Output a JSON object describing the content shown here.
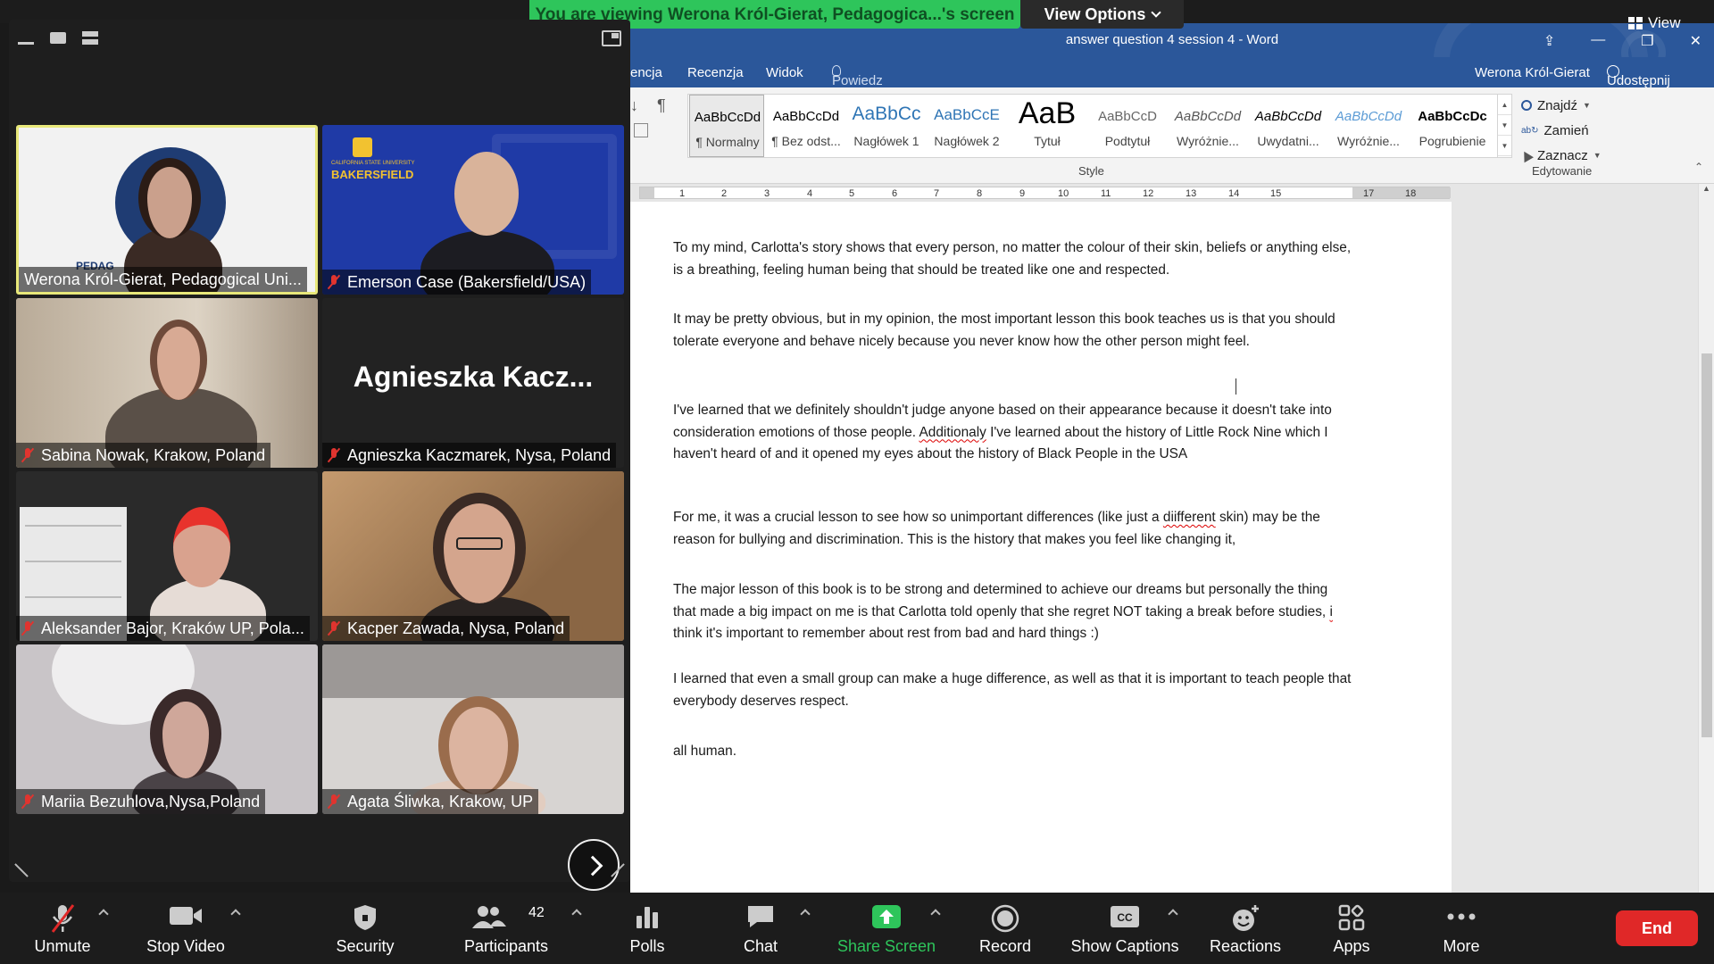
{
  "zoom": {
    "banner": "You are viewing Werona Król-Gierat, Pedagogica...'s screen",
    "view_options": "View Options",
    "view": "View",
    "toolbar": {
      "unmute": "Unmute",
      "stop_video": "Stop Video",
      "security": "Security",
      "participants": "Participants",
      "participants_count": "42",
      "polls": "Polls",
      "chat": "Chat",
      "share_screen": "Share Screen",
      "record": "Record",
      "show_captions": "Show Captions",
      "reactions": "Reactions",
      "apps": "Apps",
      "more": "More",
      "end": "End"
    },
    "participants": [
      {
        "name": "Werona Król-Gierat, Pedagogical Uni...",
        "muted": false,
        "active": true
      },
      {
        "name": "Emerson Case (Bakersfield/USA)",
        "muted": true
      },
      {
        "name": "Sabina Nowak, Krakow, Poland",
        "muted": true
      },
      {
        "name": "Agnieszka Kaczmarek, Nysa, Poland",
        "muted": true,
        "display_name": "Agnieszka  Kacz..."
      },
      {
        "name": "Aleksander Bajor, Kraków UP, Pola...",
        "muted": true
      },
      {
        "name": "Kacper Zawada, Nysa, Poland",
        "muted": true
      },
      {
        "name": "Mariia Bezuhlova,Nysa,Poland",
        "muted": true
      },
      {
        "name": "Agata Śliwka, Krakow, UP",
        "muted": true
      }
    ],
    "tile_text": {
      "pedag": "PEDAG",
      "bakersfield": "BAKERSFIELD",
      "csu": "CALIFORNIA STATE UNIVERSITY"
    },
    "colors": {
      "banner_green": "#2ec55b",
      "share_green": "#2ec55b",
      "end_red": "#e02828",
      "grid_blue": "#2d8cff"
    }
  },
  "word": {
    "title": "answer question 4 session 4 - Word",
    "tabs": {
      "tab1": "encja",
      "tab2": "Recenzja",
      "tab3": "Widok"
    },
    "tell_me": "Powiedz mi, co chcesz zrobić...",
    "user": "Werona Król-Gierat",
    "share": "Udostępnij",
    "styles": [
      {
        "preview": "AaBbCcDd",
        "label": "¶ Normalny"
      },
      {
        "preview": "AaBbCcDd",
        "label": "¶ Bez odst..."
      },
      {
        "preview": "AaBbCc",
        "label": "Nagłówek 1"
      },
      {
        "preview": "AaBbCcE",
        "label": "Nagłówek 2"
      },
      {
        "preview": "AaB",
        "label": "Tytuł"
      },
      {
        "preview": "AaBbCcD",
        "label": "Podtytuł"
      },
      {
        "preview": "AaBbCcDd",
        "label": "Wyróżnie..."
      },
      {
        "preview": "AaBbCcDd",
        "label": "Uwydatni..."
      },
      {
        "preview": "AaBbCcDd",
        "label": "Wyróżnie..."
      },
      {
        "preview": "AaBbCcDc",
        "label": "Pogrubienie"
      }
    ],
    "styles_group": "Style",
    "editing": {
      "find": "Znajdź",
      "replace": "Zamień",
      "select": "Zaznacz",
      "group": "Edytowanie"
    },
    "ruler_numbers": [
      "1",
      "2",
      "3",
      "4",
      "5",
      "6",
      "7",
      "8",
      "9",
      "10",
      "11",
      "12",
      "13",
      "14",
      "15",
      "17",
      "18"
    ],
    "paragraphs": {
      "p1": "To my mind, Carlotta's story shows that every person, no matter the colour of their skin, beliefs or anything else, is a breathing, feeling human being that should be treated like one and respected.",
      "p2": "It may be pretty obvious, but in my opinion, the most important lesson this book teaches us is that you should tolerate everyone and behave nicely because you never know how the other person might feel.",
      "p3a": "I've learned that we definitely shouldn't judge anyone based on their appearance because it doesn't take into consideration emotions of those people. ",
      "p3b": "Additionaly",
      "p3c": " I've learned about the history of Little Rock Nine which I haven't heard of and it opened my eyes about the history of Black People in the USA",
      "p4a": "For me, it was a crucial lesson to see how so unimportant differences (like just a ",
      "p4b": "diifferent",
      "p4c": " skin) may be the reason for bullying and discrimination. This is the history that makes you feel like changing it,",
      "p5a": "The major lesson of this book is to be strong and determined to achieve our dreams but personally the thing that made a big impact on me is that Carlotta told openly that she regret NOT taking a break before studies, ",
      "p5b": "i",
      "p5c": " think it's important to remember about rest from bad and hard things :)",
      "p6": "I learned that even a small group can make a huge difference, as well as that it is important to teach people that everybody deserves  respect.",
      "p7": "all human."
    }
  }
}
